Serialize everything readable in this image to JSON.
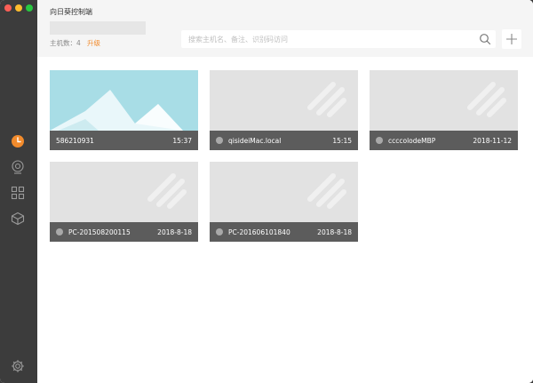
{
  "header": {
    "app_title": "向日葵控制端",
    "host_count_label": "主机数：4",
    "upgrade_label": "升级"
  },
  "search": {
    "placeholder": "搜索主机名、备注、识别码访问"
  },
  "hosts": [
    {
      "name": "586210931",
      "time": "15:37",
      "thumbnail": true
    },
    {
      "name": "qisideiMac.local",
      "time": "15:15",
      "thumbnail": false
    },
    {
      "name": "ccccolodeMBP",
      "time": "2018-11-12",
      "thumbnail": false
    },
    {
      "name": "PC-201508200115",
      "time": "2018-8-18",
      "thumbnail": false
    },
    {
      "name": "PC-201606101840",
      "time": "2018-8-18",
      "thumbnail": false
    }
  ],
  "icons": {
    "sidebar": [
      "clock-icon",
      "remote-control-icon",
      "apps-grid-icon",
      "cube-icon",
      "settings-gear-icon"
    ],
    "header": [
      "search-icon",
      "plus-icon"
    ]
  },
  "colors": {
    "accent": "#f28b2c",
    "sidebar": "#3c3c3c",
    "card_bar": "#5c5c5c",
    "card_placeholder": "#e2e2e2"
  }
}
